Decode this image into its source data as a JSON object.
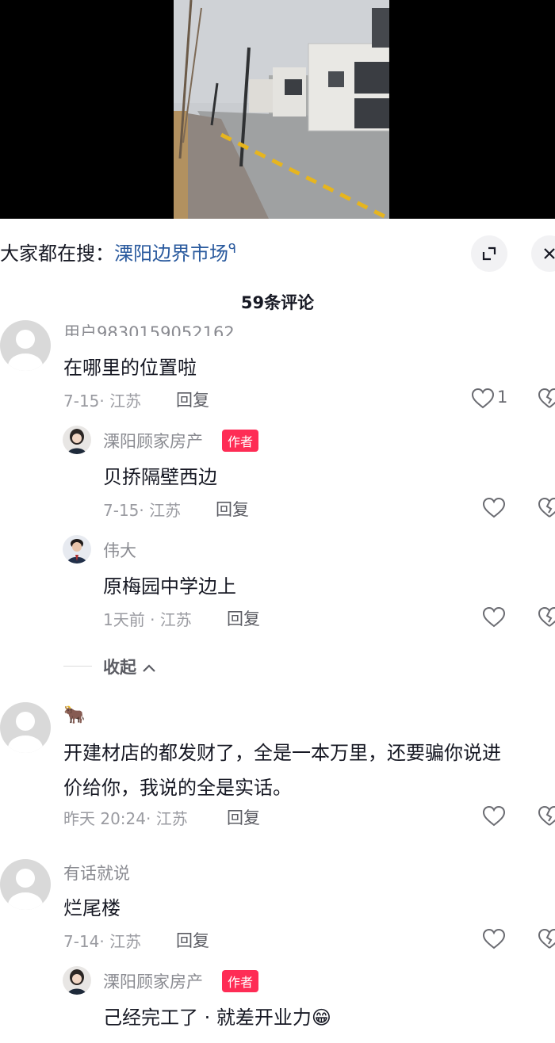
{
  "search": {
    "prefix": "大家都在搜：",
    "term": "溧阳边界市场",
    "expand_icon": "expand-icon",
    "close_icon": "close-icon"
  },
  "comments_count": "59条评论",
  "comments": [
    {
      "username": "用户9830159052162",
      "content": "在哪里的位置啦",
      "time": "7-15· 江苏",
      "reply": "回复",
      "likes": "1",
      "replies": [
        {
          "username": "溧阳顾家房产",
          "tag": "作者",
          "content": "贝挢隔壁西边",
          "time": "7-15· 江苏",
          "reply": "回复"
        },
        {
          "username": "伟大",
          "content": "原梅园中学边上",
          "time": "1天前 · 江苏",
          "reply": "回复"
        }
      ],
      "collapse": "收起"
    },
    {
      "username_emoji": "🐂",
      "content_line1": "开建材店的都发财了，全是一本万里，还要骗你说进",
      "content_line2": "价给你，我说的全是实话。",
      "time": "昨天 20:24· 江苏",
      "reply": "回复"
    },
    {
      "username": "有话就说",
      "content": "烂尾楼",
      "time": "7-14· 江苏",
      "reply": "回复",
      "replies": [
        {
          "username": "溧阳顾家房产",
          "tag": "作者",
          "content": "己经完工了 · 就差开业力😁"
        }
      ]
    }
  ],
  "colors": {
    "author_tag": "#fe2c55",
    "search_link": "#2a5a9e"
  }
}
